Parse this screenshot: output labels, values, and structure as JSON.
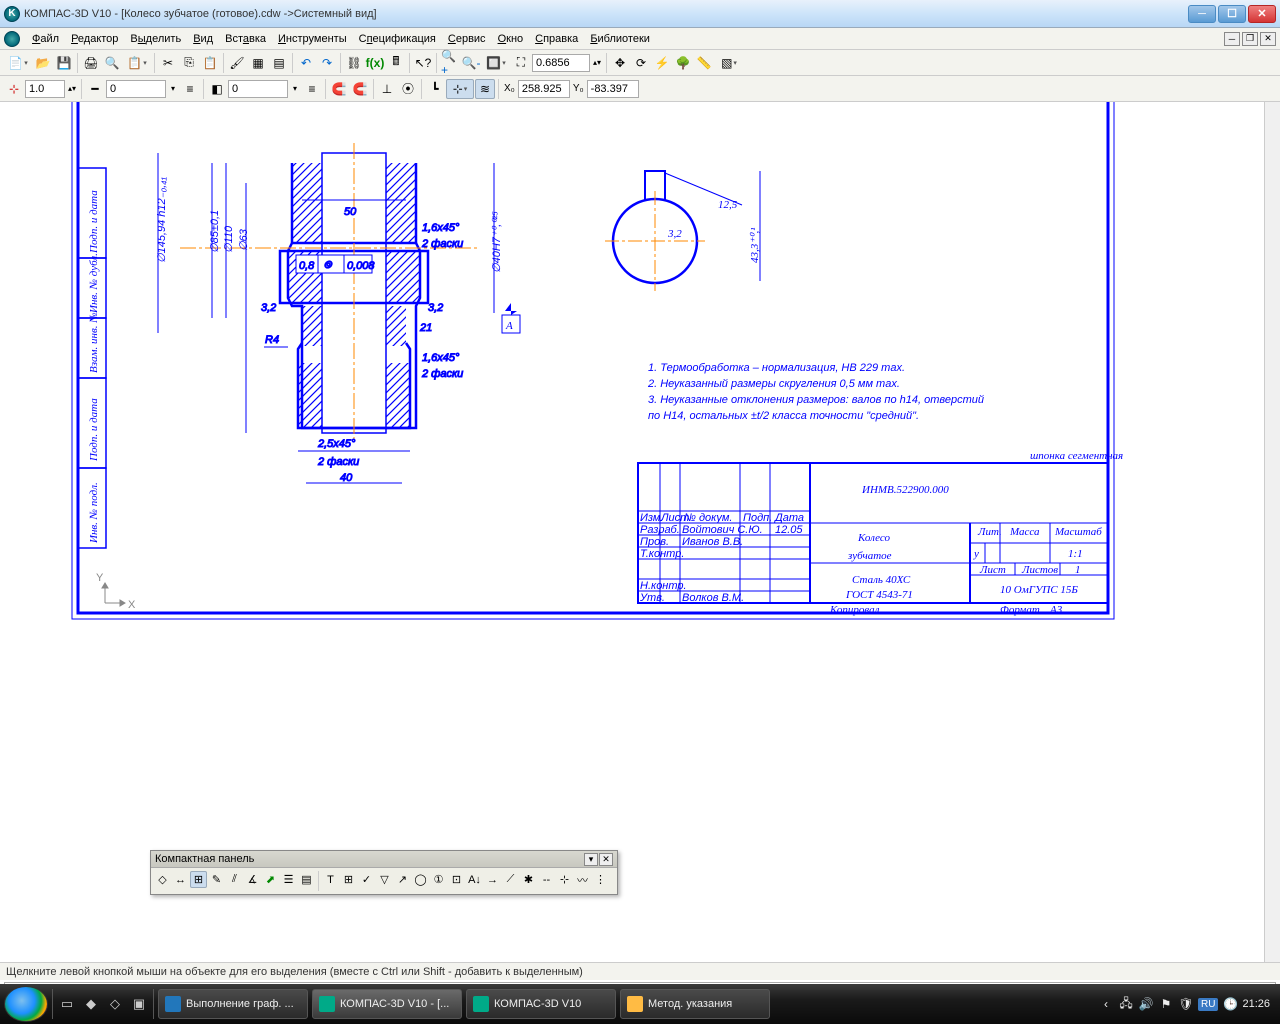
{
  "window": {
    "title": "КОМПАС-3D V10 - [Колесо зубчатое (готовое).cdw ->Системный вид]"
  },
  "menu": {
    "items": [
      "Файл",
      "Редактор",
      "Выделить",
      "Вид",
      "Вставка",
      "Инструменты",
      "Спецификация",
      "Сервис",
      "Окно",
      "Справка",
      "Библиотеки"
    ]
  },
  "toolbar2": {
    "zoom": "0.6856"
  },
  "toolbar3": {
    "step": "1.0",
    "style": "0",
    "val2": "0",
    "x": "258.925",
    "y": "-83.397"
  },
  "floatpanel": {
    "title": "Компактная панель"
  },
  "status": {
    "text": "Щелкните левой кнопкой мыши на объекте для его выделения (вместе с Ctrl или Shift - добавить к выделенным)"
  },
  "taskbar": {
    "items": [
      "Выполнение граф. ...",
      "КОМПАС-3D V10 - [...",
      "КОМПАС-3D V10",
      "Метод. указания"
    ],
    "lang": "RU",
    "time": "21:26"
  },
  "drawing": {
    "dims": {
      "d50": "50",
      "r4": "R4",
      "d25x45": "2,5x45°",
      "faski2": "2 фаски",
      "d40": "40",
      "d16x45": "1,6x45°",
      "d21": "21",
      "d08": "0,8",
      "d0008": "0,008",
      "d32": "3,2",
      "diam145": "∅145,94 h12₋₀,₄₁",
      "diam85": "∅85±0,1",
      "diam110": "∅110",
      "diam63": "∅63",
      "diam40h7": "∅40H7⁺⁰,⁰²⁵",
      "A": "А",
      "d125": "12,5",
      "d433": "43,3⁺⁰,¹",
      "d32b": "3,2"
    },
    "notes": {
      "n1": "1. Термообработка – нормализация, HB 229 max.",
      "n2": "2. Неуказанный размеры скругления 0,5 мм max.",
      "n3": "3. Неуказанные отклонения размеров: валов по h14, отверстий",
      "n3b": "   по H14, остальных ±t/2 класса точности \"средний\"."
    },
    "stamp_small": "шпонка сегментная",
    "titleblock": {
      "code": "ИНМВ.522900.000",
      "name1": "Колесо",
      "name2": "зубчатое",
      "material1": "Сталь 40ХС",
      "material2": "ГОСТ 4543-71",
      "izm": "Изм.",
      "list": "Лист",
      "ndokum": "№ докум.",
      "podp": "Подп.",
      "data": "Дата",
      "razrab": "Разраб.",
      "razrab_name": "Войтович С.Ю.",
      "razrab_date": "12.05",
      "prov": "Пров.",
      "prov_name": "Иванов В.В.",
      "tkontr": "Т.контр.",
      "nkontr": "Н.контр.",
      "utv": "Утв.",
      "utv_name": "Волков В.М.",
      "lit": "Лит.",
      "massa": "Масса",
      "mashtab": "Масштаб",
      "scale": "1:1",
      "u": "у",
      "list2": "Лист",
      "listov": "Листов",
      "listov_n": "1",
      "org": "10 ОмГУПС 15Б",
      "kopiroval": "Копировал",
      "format": "Формат",
      "a3": "А3"
    },
    "sidestamp": {
      "s1": "Подп. и дата",
      "s2": "Инв. № дубл.",
      "s3": "Взам. инв. №",
      "s4": "Подп. и дата",
      "s5": "Инв. № подл."
    }
  }
}
